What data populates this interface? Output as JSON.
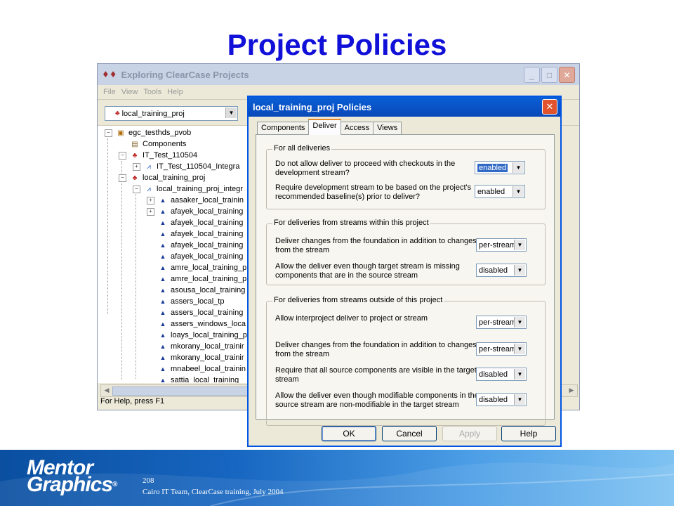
{
  "slide": {
    "title": "Project Policies"
  },
  "explorer": {
    "title": "Exploring ClearCase Projects",
    "menu": [
      "File",
      "View",
      "Tools",
      "Help"
    ],
    "project_combo": "local_training_proj",
    "status": "For Help, press F1",
    "tree": [
      {
        "label": "egc_testhds_pvob",
        "icon": "pvob-icon"
      },
      {
        "label": "Components",
        "icon": "components-folder-icon"
      },
      {
        "label": "IT_Test_110504",
        "icon": "project-icon"
      },
      {
        "label": "IT_Test_110504_Integra",
        "icon": "integration-stream-icon"
      },
      {
        "label": "local_training_proj",
        "icon": "project-icon"
      },
      {
        "label": "local_training_proj_integr",
        "icon": "integration-stream-icon"
      },
      {
        "label": "aasaker_local_trainin",
        "icon": "dev-stream-icon"
      },
      {
        "label": "afayek_local_training",
        "icon": "dev-stream-icon"
      },
      {
        "label": "afayek_local_training",
        "icon": "dev-stream-icon"
      },
      {
        "label": "afayek_local_training",
        "icon": "dev-stream-icon"
      },
      {
        "label": "afayek_local_training",
        "icon": "dev-stream-icon"
      },
      {
        "label": "afayek_local_training",
        "icon": "dev-stream-icon"
      },
      {
        "label": "amre_local_training_p",
        "icon": "dev-stream-icon"
      },
      {
        "label": "amre_local_training_p",
        "icon": "dev-stream-icon"
      },
      {
        "label": "asousa_local_training",
        "icon": "dev-stream-icon"
      },
      {
        "label": "assers_local_tp",
        "icon": "dev-stream-icon"
      },
      {
        "label": "assers_local_training",
        "icon": "dev-stream-icon"
      },
      {
        "label": "assers_windows_loca",
        "icon": "dev-stream-icon"
      },
      {
        "label": "loays_local_training_p",
        "icon": "dev-stream-icon"
      },
      {
        "label": "mkorany_local_trainir",
        "icon": "dev-stream-icon"
      },
      {
        "label": "mkorany_local_trainir",
        "icon": "dev-stream-icon"
      },
      {
        "label": "mnabeel_local_trainin",
        "icon": "dev-stream-icon"
      },
      {
        "label": "sattia_local_training",
        "icon": "dev-stream-icon"
      }
    ]
  },
  "dialog": {
    "title": "local_training_proj Policies",
    "tabs": [
      "Components",
      "Deliver",
      "Access",
      "Views"
    ],
    "active_tab": "Deliver",
    "groups": [
      {
        "label": "For all deliveries",
        "rows": [
          {
            "text": "Do not allow deliver to proceed with checkouts in the development stream?",
            "value": "enabled"
          },
          {
            "text": "Require development stream to be based on the project's recommended baseline(s) prior to deliver?",
            "value": "enabled"
          }
        ]
      },
      {
        "label": "For deliveries from streams within this project",
        "rows": [
          {
            "text": "Deliver changes from the foundation in addition to changes from the stream",
            "value": "per-stream"
          },
          {
            "text": "Allow the deliver even though target stream is missing components that are in the source stream",
            "value": "disabled"
          }
        ]
      },
      {
        "label": "For deliveries from streams outside of this project",
        "rows": [
          {
            "text": "Allow interproject deliver to project or stream",
            "value": "per-stream"
          },
          {
            "text": "Deliver changes from the foundation in addition to changes from the stream",
            "value": "per-stream"
          },
          {
            "text": "Require that all source components are visible in the target stream",
            "value": "disabled"
          },
          {
            "text": "Allow the deliver even though modifiable components in the source stream are non-modifiable in the target stream",
            "value": "disabled"
          }
        ]
      }
    ],
    "buttons": {
      "ok": "OK",
      "cancel": "Cancel",
      "apply": "Apply",
      "help": "Help"
    }
  },
  "footer": {
    "logo_line1": "Mentor",
    "logo_line2": "Graphics",
    "logo_mark": "®",
    "page": "208",
    "text": "Cairo IT Team, ClearCase training, July 2004"
  }
}
